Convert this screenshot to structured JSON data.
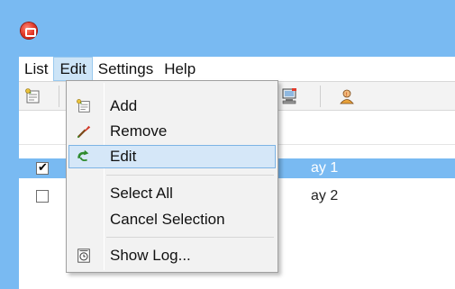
{
  "menubar": {
    "items": [
      {
        "label": "List"
      },
      {
        "label": "Edit",
        "active": true
      },
      {
        "label": "Settings"
      },
      {
        "label": "Help"
      }
    ]
  },
  "toolbar": {
    "buttons": [
      "add-list-icon",
      "pc-icon",
      "warning-user-icon"
    ]
  },
  "list": {
    "rows": [
      {
        "label": "ay 1",
        "checked": true,
        "selected": true
      },
      {
        "label": "ay 2",
        "checked": false,
        "selected": false
      }
    ]
  },
  "edit_menu": {
    "add": {
      "label": "Add",
      "icon": "add-icon"
    },
    "remove": {
      "label": "Remove",
      "icon": "remove-icon"
    },
    "edit": {
      "label": "Edit",
      "icon": "edit-icon",
      "highlighted": true
    },
    "select_all": {
      "label": "Select All"
    },
    "cancel_selection": {
      "label": "Cancel Selection"
    },
    "show_log": {
      "label": "Show Log...",
      "icon": "log-icon"
    }
  },
  "colors": {
    "titlebar": "#79baf2",
    "selection": "#79baf2",
    "menu_hover": "#d5e7f8"
  }
}
